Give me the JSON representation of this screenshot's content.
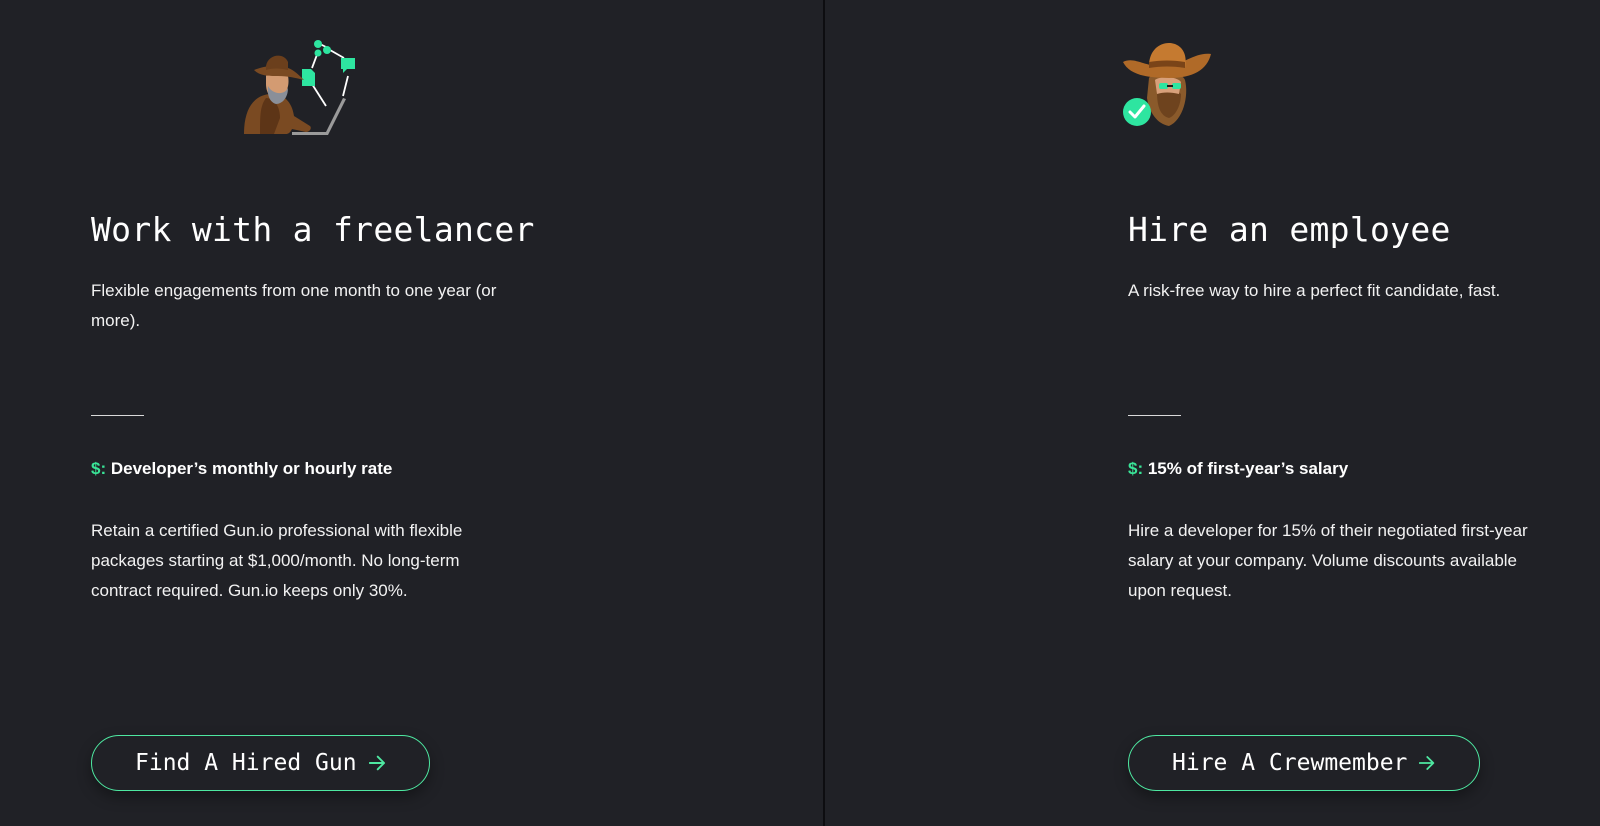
{
  "freelancer": {
    "title": "Work with a freelancer",
    "subtitle": "Flexible engagements from one month to one year (or more).",
    "price_symbol": "$:",
    "price_label": " Developer’s monthly or hourly rate",
    "description": "Retain a certified Gun.io professional with flexible packages starting at $1,000/month. No long-term contract required. Gun.io keeps only 30%.",
    "cta_label": "Find A Hired Gun",
    "illustration_icon": "freelancer-cowboy-laptop-icon"
  },
  "employee": {
    "title": "Hire an employee",
    "subtitle": "A risk-free way to hire a perfect fit candidate, fast.",
    "price_symbol": "$:",
    "price_label": " 15% of first-year’s salary",
    "description": "Hire a developer for 15% of their negotiated first-year salary at your company. Volume discounts available upon request.",
    "cta_label": "Hire A Crewmember",
    "illustration_icon": "verified-cowboy-avatar-icon"
  },
  "colors": {
    "background": "#202126",
    "accent": "#39e497",
    "divider": "#0d0d10"
  }
}
